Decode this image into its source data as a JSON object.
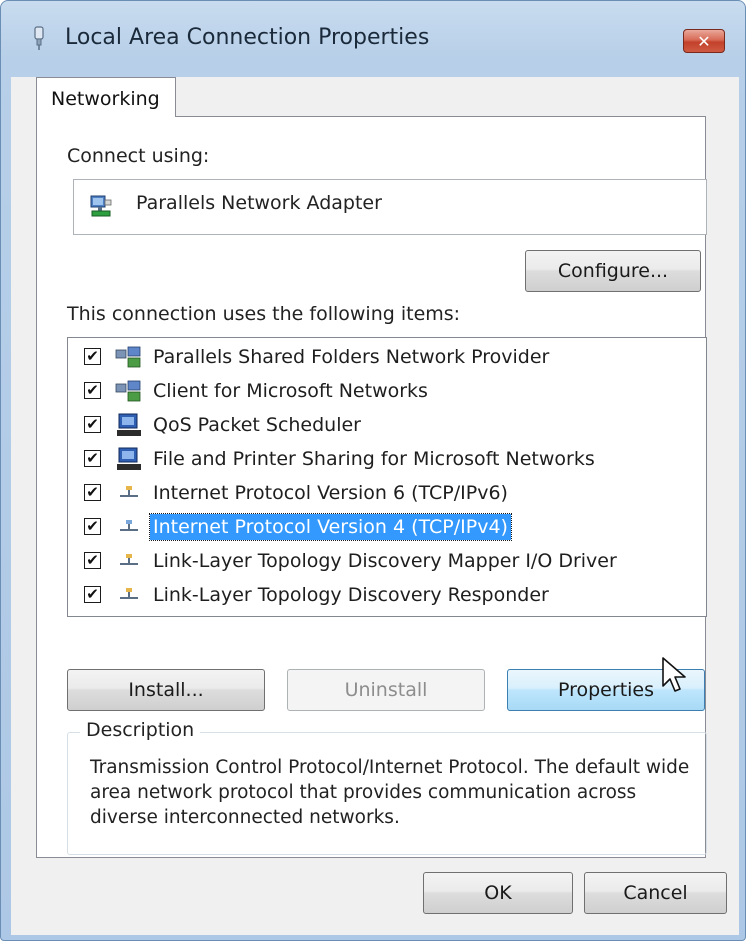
{
  "window": {
    "title": "Local Area Connection Properties",
    "close_label": "✕"
  },
  "tabs": [
    {
      "label": "Networking",
      "active": true
    }
  ],
  "networking": {
    "connect_using_label": "Connect using:",
    "adapter_name": "Parallels Network Adapter",
    "configure_button": "Configure...",
    "items_label": "This connection uses the following items:",
    "items": [
      {
        "label": "Parallels Shared Folders Network Provider",
        "checked": true,
        "icon": "network-client-icon",
        "selected": false
      },
      {
        "label": "Client for Microsoft Networks",
        "checked": true,
        "icon": "network-client-icon",
        "selected": false
      },
      {
        "label": "QoS Packet Scheduler",
        "checked": true,
        "icon": "network-service-icon",
        "selected": false
      },
      {
        "label": "File and Printer Sharing for Microsoft Networks",
        "checked": true,
        "icon": "network-service-icon",
        "selected": false
      },
      {
        "label": "Internet Protocol Version 6 (TCP/IPv6)",
        "checked": true,
        "icon": "protocol-icon",
        "selected": false
      },
      {
        "label": "Internet Protocol Version 4 (TCP/IPv4)",
        "checked": true,
        "icon": "protocol-icon",
        "selected": true
      },
      {
        "label": "Link-Layer Topology Discovery Mapper I/O Driver",
        "checked": true,
        "icon": "protocol-icon",
        "selected": false
      },
      {
        "label": "Link-Layer Topology Discovery Responder",
        "checked": true,
        "icon": "protocol-icon",
        "selected": false
      }
    ],
    "install_button": "Install...",
    "uninstall_button": "Uninstall",
    "properties_button": "Properties",
    "description_legend": "Description",
    "description_text": "Transmission Control Protocol/Internet Protocol. The default wide area network protocol that provides communication across diverse interconnected networks."
  },
  "footer": {
    "ok_button": "OK",
    "cancel_button": "Cancel"
  },
  "colors": {
    "selection": "#3399ff",
    "title_bar": "#b7cfe8",
    "close_button": "#c3412a"
  }
}
